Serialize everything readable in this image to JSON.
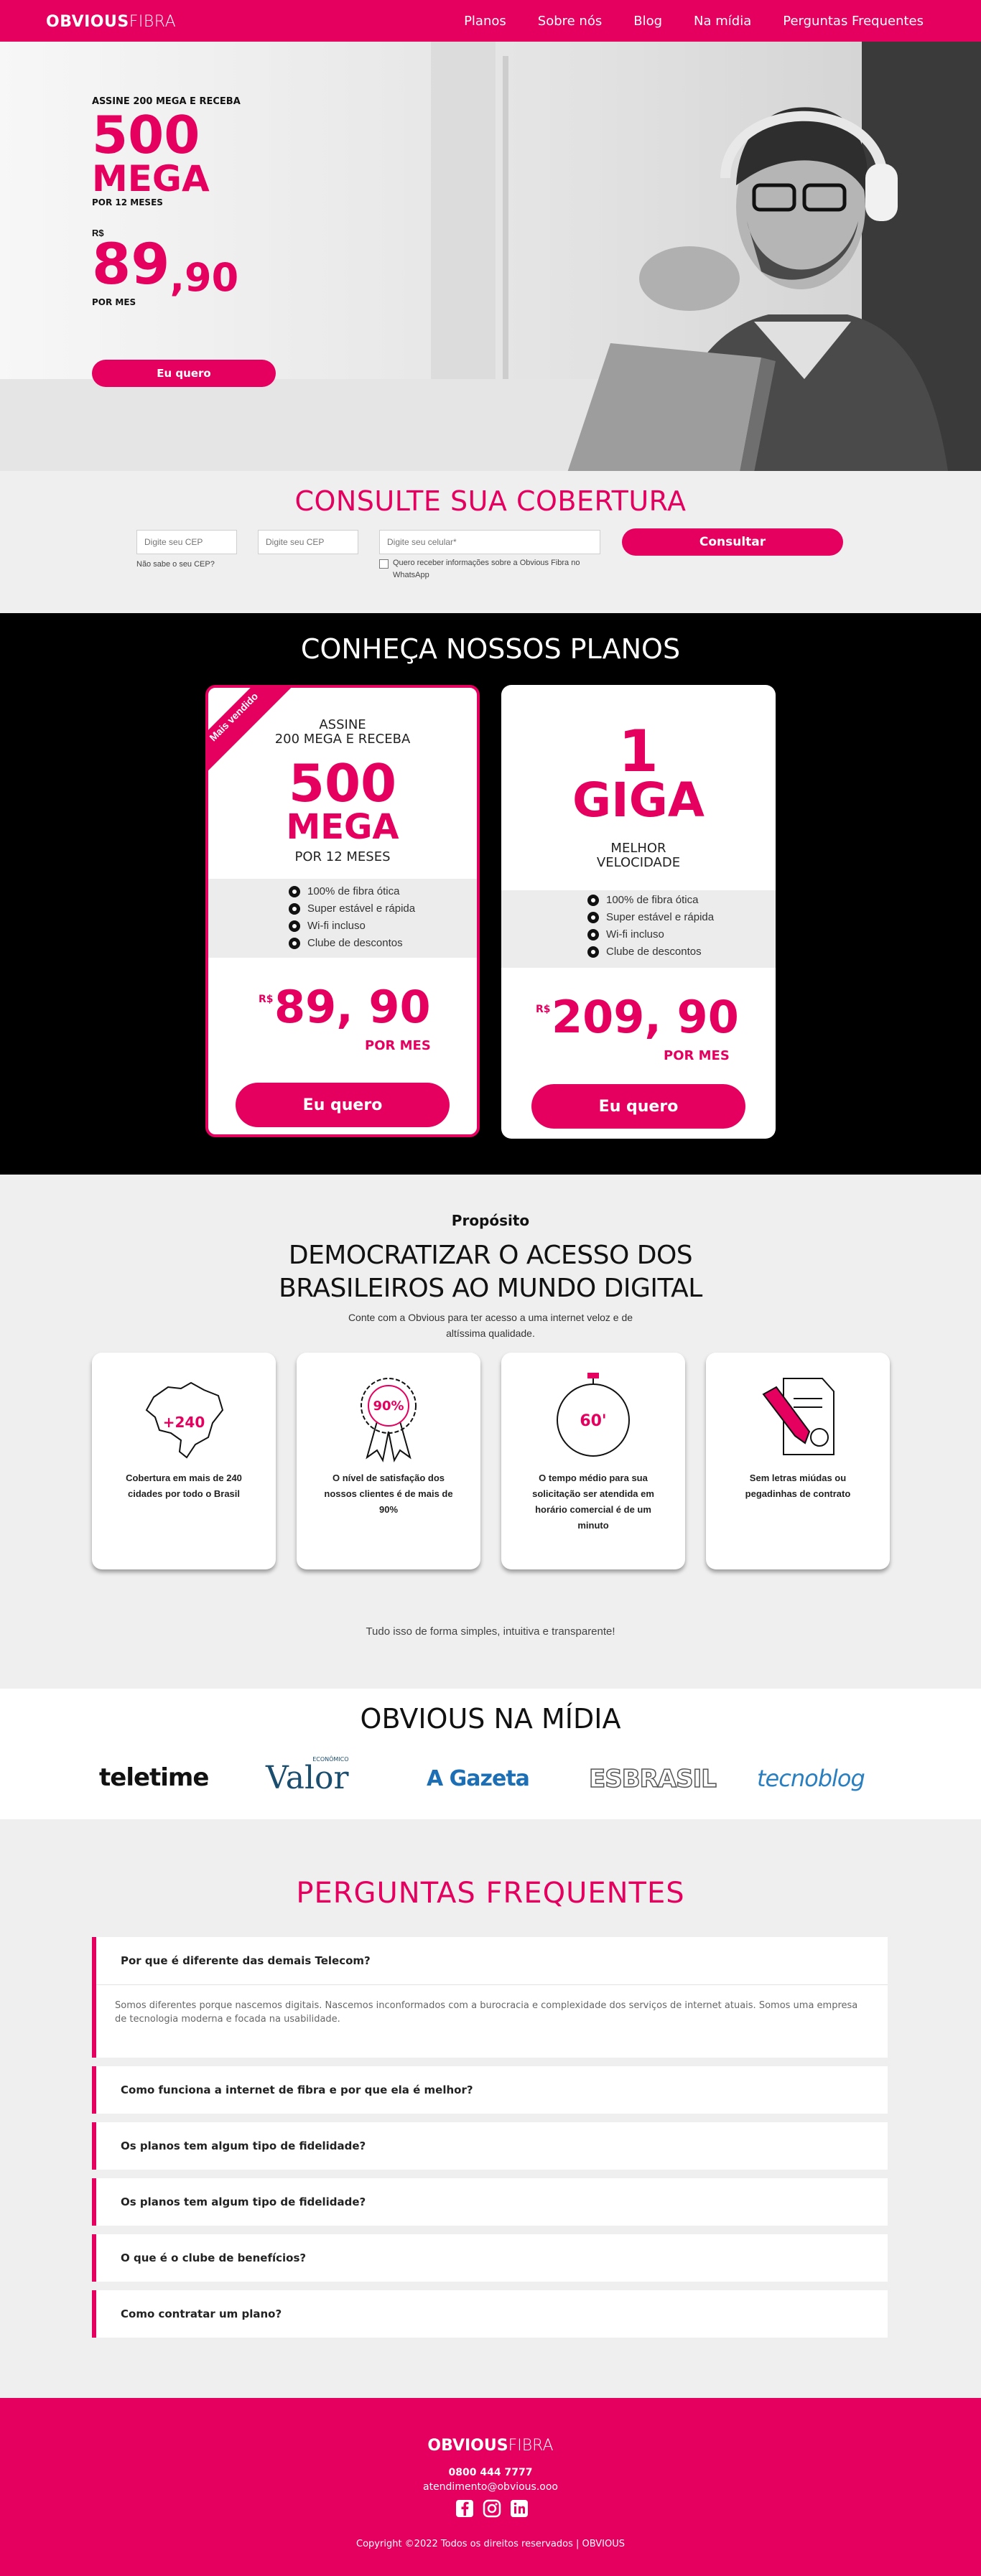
{
  "brand": {
    "logo_bold": "OBVIOUS",
    "logo_light": "FIBRA",
    "pink": "#e5005f"
  },
  "nav": {
    "items": [
      "Planos",
      "Sobre nós",
      "Blog",
      "Na mídia",
      "Perguntas Frequentes"
    ]
  },
  "hero": {
    "kicker": "ASSINE 200 MEGA E RECEBA",
    "speed": "500",
    "unit": "MEGA",
    "period": "POR 12 MESES",
    "currency": "R$",
    "price_int": "89",
    "price_cents": ",90",
    "per": "POR MES",
    "cta": "Eu quero"
  },
  "coverage": {
    "title": "CONSULTE SUA COBERTURA",
    "cep1_placeholder": "Digite seu CEP",
    "cep2_placeholder": "Digite seu CEP",
    "phone_placeholder": "Digite seu celular*",
    "help_link": "Não sabe o seu CEP?",
    "whatsapp_optin": "Quero receber informações sobre a Obvious Fibra no WhatsApp",
    "submit": "Consultar"
  },
  "plans": {
    "title": "CONHEÇA NOSSOS PLANOS",
    "cards": [
      {
        "ribbon": "Mais vendido",
        "sub1": "ASSINE",
        "sub2": "200 MEGA E RECEBA",
        "big1": "500",
        "big2": "MEGA",
        "caption": "POR 12 MESES",
        "features": [
          "100% de fibra ótica",
          "Super estável e rápida",
          "Wi-fi incluso",
          "Clube de descontos"
        ],
        "currency": "R$",
        "price": "89, 90",
        "per": "POR MES",
        "cta": "Eu quero"
      },
      {
        "big1": "1",
        "big2": "GIGA",
        "caption1": "MELHOR",
        "caption2": "VELOCIDADE",
        "features": [
          "100% de fibra ótica",
          "Super estável e rápida",
          "Wi-fi incluso",
          "Clube de descontos"
        ],
        "currency": "R$",
        "price": "209, 90",
        "per": "POR MES",
        "cta": "Eu quero"
      }
    ]
  },
  "purpose": {
    "kicker": "Propósito",
    "headline": "DEMOCRATIZAR O ACESSO DOS BRASILEIROS AO MUNDO DIGITAL",
    "text": "Conte com a Obvious para ter acesso a uma internet veloz e de altíssima qualidade.",
    "features": [
      {
        "icon": "brazil-map-icon",
        "badge": "+240",
        "text": "Cobertura em mais de 240 cidades por todo o Brasil"
      },
      {
        "icon": "award-ribbon-icon",
        "badge": "90%",
        "text": "O nível de satisfação dos nossos clientes é de mais de 90%"
      },
      {
        "icon": "stopwatch-icon",
        "badge": "60'",
        "text": "O tempo médio para sua solicitação ser atendida em horário comercial é de um minuto"
      },
      {
        "icon": "contract-pen-icon",
        "badge": "",
        "text": "Sem letras miúdas ou pegadinhas de contrato"
      }
    ],
    "footer": "Tudo isso de forma simples, intuitiva e transparente!"
  },
  "media": {
    "title": "OBVIOUS NA MÍDIA",
    "logos": [
      "teletime",
      "Valor",
      "A Gazeta",
      "ESBRASIL",
      "tecnoblog"
    ],
    "valor_small": "ECONÔMICO"
  },
  "faq": {
    "title": "PERGUNTAS FREQUENTES",
    "items": [
      {
        "q": "Por que é diferente das demais Telecom?",
        "a": "Somos diferentes porque nascemos digitais. Nascemos inconformados com a burocracia e complexidade dos serviços de internet atuais. Somos uma empresa de tecnologia moderna e focada na usabilidade."
      },
      {
        "q": "Como funciona a internet de fibra e por que ela é melhor?"
      },
      {
        "q": "Os planos tem algum tipo de fidelidade?"
      },
      {
        "q": "Os planos tem algum tipo de fidelidade?"
      },
      {
        "q": "O que é o clube de benefícios?"
      },
      {
        "q": "Como contratar um plano?"
      }
    ]
  },
  "footer": {
    "phone": "0800 444 7777",
    "email": "atendimento@obvious.ooo",
    "copyright": "Copyright ©2022 Todos os direitos reservados | OBVIOUS",
    "social": [
      "facebook-icon",
      "instagram-icon",
      "linkedin-icon"
    ]
  }
}
